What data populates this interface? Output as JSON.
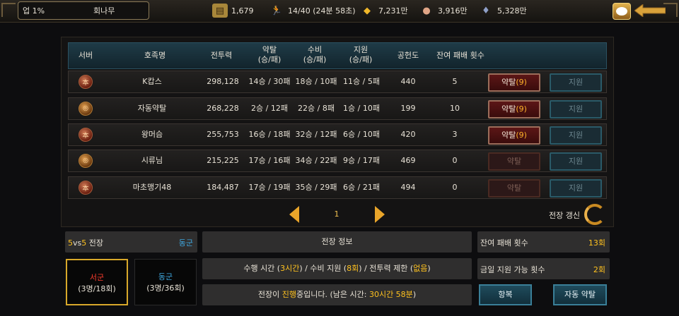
{
  "topbar": {
    "level": "업 1%",
    "nickname": "회나무",
    "resources": [
      {
        "icon": "scroll-icon",
        "value": "1,679"
      },
      {
        "icon": "runner-icon",
        "value": "14/40 (24분 58초)"
      },
      {
        "icon": "gold-ingot-icon",
        "value": "7,231만"
      },
      {
        "icon": "meat-icon",
        "value": "3,916만"
      },
      {
        "icon": "ore-icon",
        "value": "5,328만"
      }
    ]
  },
  "table": {
    "headers": {
      "server": "서버",
      "clan": "호족명",
      "power": "전투력",
      "loot": "약탈",
      "loot_sub": "(승/패)",
      "defense": "수비",
      "defense_sub": "(승/패)",
      "support": "지원",
      "support_sub": "(승/패)",
      "contrib": "공헌도",
      "remaining": "잔여 패배 횟수"
    },
    "rows": [
      {
        "server": "west",
        "name": "K캅스",
        "power": "298,128",
        "loot": "14승 / 30패",
        "defense": "18승 / 10패",
        "support": "11승 / 5패",
        "contrib": "440",
        "remaining": "5",
        "loot_btn": "약탈",
        "loot_count": "(9)",
        "loot_enabled": true,
        "support_btn": "지원"
      },
      {
        "server": "east",
        "name": "자동약탈",
        "power": "268,228",
        "loot": "2승 / 12패",
        "defense": "22승 / 8패",
        "support": "1승 / 10패",
        "contrib": "199",
        "remaining": "10",
        "loot_btn": "약탈",
        "loot_count": "(9)",
        "loot_enabled": true,
        "support_btn": "지원"
      },
      {
        "server": "west",
        "name": "왕머슴",
        "power": "255,753",
        "loot": "16승 / 18패",
        "defense": "32승 / 12패",
        "support": "6승 / 10패",
        "contrib": "420",
        "remaining": "3",
        "loot_btn": "약탈",
        "loot_count": "(9)",
        "loot_enabled": true,
        "support_btn": "지원"
      },
      {
        "server": "east",
        "name": "시류님",
        "power": "215,225",
        "loot": "17승 / 16패",
        "defense": "34승 / 22패",
        "support": "9승 / 17패",
        "contrib": "469",
        "remaining": "0",
        "loot_btn": "약탈",
        "loot_count": "",
        "loot_enabled": false,
        "support_btn": "지원"
      },
      {
        "server": "west",
        "name": "마초맹기48",
        "power": "184,487",
        "loot": "17승 / 19패",
        "defense": "35승 / 29패",
        "support": "6승 / 21패",
        "contrib": "494",
        "remaining": "0",
        "loot_btn": "약탈",
        "loot_count": "",
        "loot_enabled": false,
        "support_btn": "지원"
      }
    ]
  },
  "pager": {
    "page": "1",
    "refresh_label": "전장 갱신"
  },
  "battle": {
    "mode_prefix_a": "5",
    "mode_vs": "vs",
    "mode_prefix_b": "5",
    "mode_suffix": " 전장",
    "my_side": "동군",
    "west_name": "서군",
    "west_stat": "(3명/18회)",
    "east_name": "동군",
    "east_stat": "(3명/36회)",
    "info_title": "전장 정보",
    "rule_a": "수행 시간 (",
    "rule_a_val": "3시간",
    "rule_b": ") / 수비 지원 (",
    "rule_b_val": "8회",
    "rule_c": ") / 전투력 제한 (",
    "rule_c_val": "없음",
    "rule_d": ")",
    "status_a": "전장이 ",
    "status_b": "진행",
    "status_c": "중입니다. (남은 시간: ",
    "status_d": "30시간 58분",
    "status_e": ")",
    "remaining_defeats_label": "잔여 패배 횟수",
    "remaining_defeats_value": "13회",
    "support_left_label": "금일 지원 가능 횟수",
    "support_left_value": "2회",
    "surrender_btn": "항복",
    "auto_loot_btn": "자동 약탈"
  },
  "colors": {
    "accent": "#ffc21f",
    "east": "#3fa8e0",
    "west": "#ff3d2e"
  }
}
